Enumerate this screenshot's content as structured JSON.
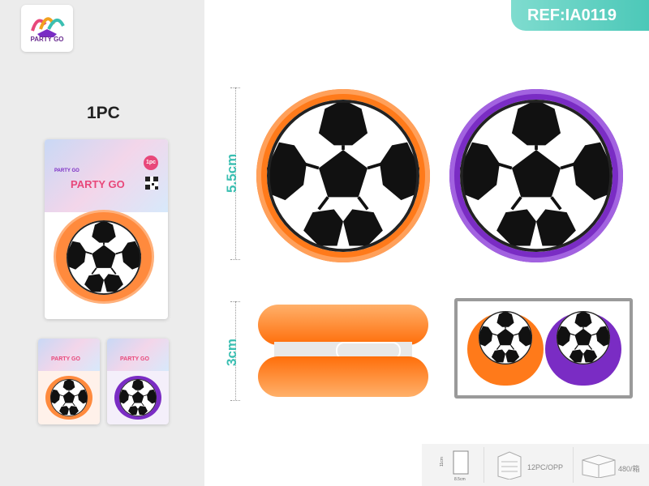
{
  "brand": {
    "logo_text": "PARTY GO"
  },
  "ref": {
    "label": "REF:IA0119"
  },
  "quantity_label": "1PC",
  "package": {
    "brand": "PARTY GO",
    "badge": "1pc",
    "logo_text": "PARTY GO"
  },
  "dimensions": {
    "diameter": "5.5cm",
    "width": "3cm"
  },
  "footer": {
    "box_height": "11cm",
    "box_width": "8.5cm",
    "inner_pack": "12PC/OPP",
    "carton": "480/箱"
  },
  "colors": {
    "accent": "#4cc8b8",
    "orange": "#ff7a1a",
    "purple": "#7a2cc4",
    "brand_pink": "#e8487a"
  },
  "icons": [
    "party-logo-icon",
    "soccer-ball-icon",
    "box-icon",
    "carton-icon",
    "qr-code-icon"
  ]
}
